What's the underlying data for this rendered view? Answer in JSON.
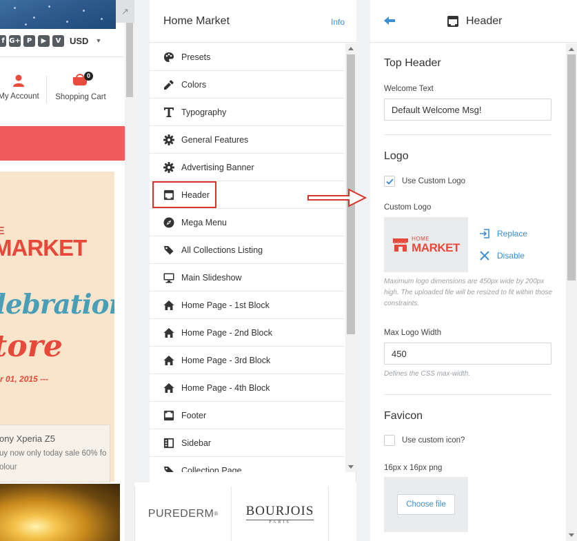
{
  "preview": {
    "currency": "USD",
    "account_label": "My Account",
    "cart_label": "Shopping Cart",
    "cart_count": "0",
    "banner_e": "E",
    "banner_market": "MARKET",
    "banner_celebration": "lebration",
    "banner_store": "tore",
    "banner_date": "r 01, 2015 ---",
    "product_title": "ony Xperia Z5",
    "product_line1": "uy now only today sale 60% fo",
    "product_line2": "olour"
  },
  "brands": {
    "left": "PUREDERM",
    "left_mark": "®",
    "right": "BOURJOIS",
    "right_sub": "PARIS"
  },
  "nav": {
    "title": "Home Market",
    "info_label": "Info",
    "items": [
      {
        "label": "Presets",
        "icon": "palette-icon"
      },
      {
        "label": "Colors",
        "icon": "eyedropper-icon"
      },
      {
        "label": "Typography",
        "icon": "typography-icon"
      },
      {
        "label": "General Features",
        "icon": "gear-icon"
      },
      {
        "label": "Advertising Banner",
        "icon": "gear-icon"
      },
      {
        "label": "Header",
        "icon": "header-layout-icon"
      },
      {
        "label": "Mega Menu",
        "icon": "compass-icon"
      },
      {
        "label": "All Collections Listing",
        "icon": "tags-icon"
      },
      {
        "label": "Main Slideshow",
        "icon": "monitor-icon"
      },
      {
        "label": "Home Page - 1st Block",
        "icon": "home-icon"
      },
      {
        "label": "Home Page - 2nd Block",
        "icon": "home-icon"
      },
      {
        "label": "Home Page - 3rd Block",
        "icon": "home-icon"
      },
      {
        "label": "Home Page - 4th Block",
        "icon": "home-icon"
      },
      {
        "label": "Footer",
        "icon": "footer-layout-icon"
      },
      {
        "label": "Sidebar",
        "icon": "sidebar-layout-icon"
      },
      {
        "label": "Collection Page",
        "icon": "tags-icon"
      }
    ]
  },
  "header_panel": {
    "title": "Header",
    "top_header": {
      "heading": "Top Header",
      "welcome_label": "Welcome Text",
      "welcome_value": "Default Welcome Msg!"
    },
    "logo": {
      "heading": "Logo",
      "use_custom_label": "Use Custom Logo",
      "use_custom_checked": true,
      "custom_logo_label": "Custom Logo",
      "logo_small": "HOME",
      "logo_big": "MARKET",
      "replace_label": "Replace",
      "disable_label": "Disable",
      "hint": "Maximum logo dimensions are 450px wide by 200px high. The uploaded file will be resized to fit within those constraints.",
      "max_width_label": "Max Logo Width",
      "max_width_value": "450",
      "max_width_hint": "Defines the CSS max-width."
    },
    "favicon": {
      "heading": "Favicon",
      "use_custom_label": "Use custom icon?",
      "use_custom_checked": false,
      "size_label": "16px x 16px png",
      "choose_label": "Choose file"
    }
  },
  "colors": {
    "accent": "#3b8ed6",
    "brand_red": "#e8483a",
    "highlight_red": "#d9342b"
  }
}
